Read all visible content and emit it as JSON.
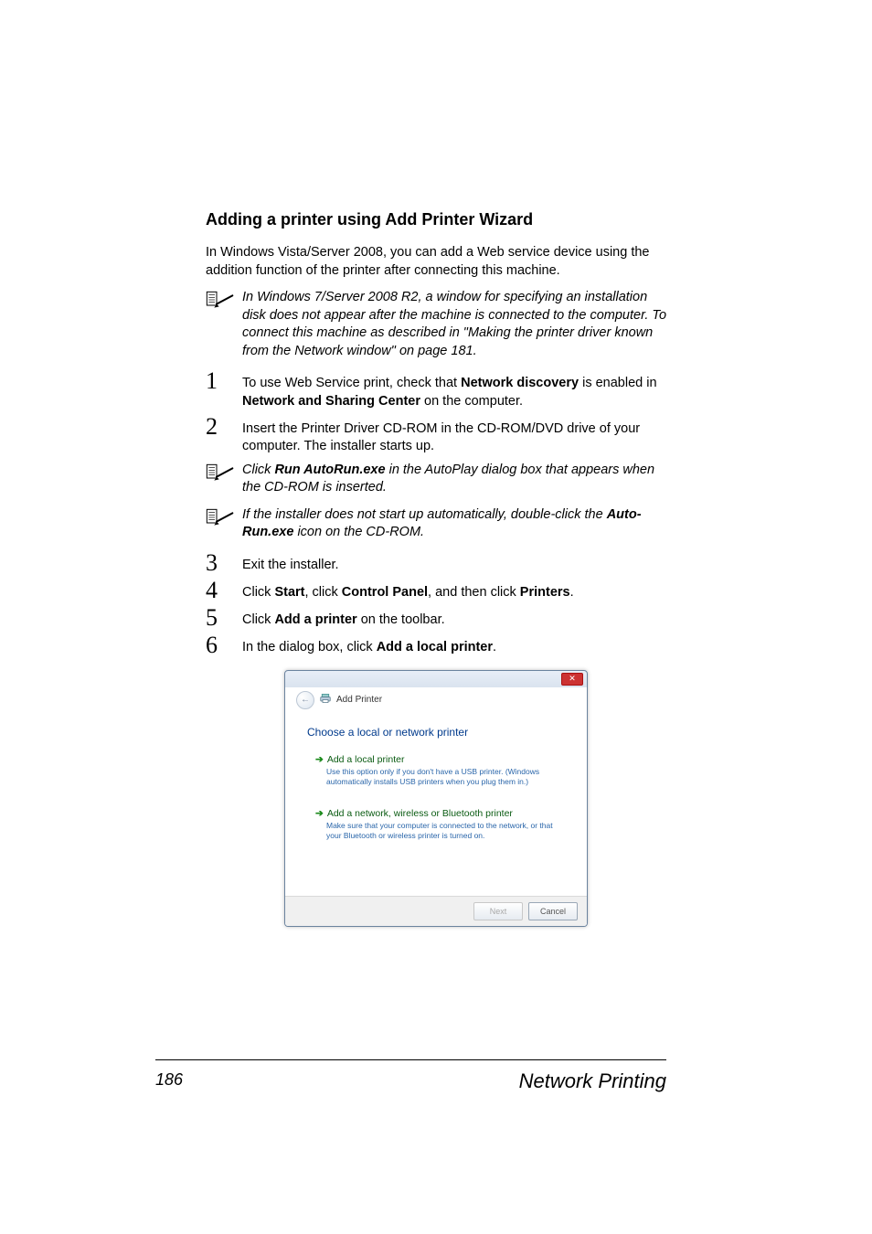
{
  "heading": "Adding a printer using Add Printer Wizard",
  "intro": "In Windows Vista/Server 2008, you can add a Web service device using the addition function of the printer after connecting this machine.",
  "notes": {
    "a": "In Windows 7/Server 2008 R2, a window for specifying an installation disk does not appear after the machine is connected to the computer. To connect this machine as described in \"Making the printer driver known from the Network window\" on page 181.",
    "b_pre": "Click ",
    "b_bold": "Run AutoRun.exe",
    "b_post": " in the AutoPlay dialog box that appears when the CD-ROM is inserted.",
    "c_pre": "If the installer does not start up automatically, double-click the ",
    "c_bold": "Auto-Run.exe",
    "c_post": " icon on the CD-ROM."
  },
  "steps": {
    "s1_pre": "To use Web Service print, check that ",
    "s1_b1": "Network discovery",
    "s1_mid": " is enabled in ",
    "s1_b2": "Network and Sharing Center",
    "s1_post": " on the computer.",
    "s2": "Insert the Printer Driver CD-ROM in the CD-ROM/DVD drive of your computer. The installer starts up.",
    "s3": "Exit the installer.",
    "s4_pre": "Click ",
    "s4_b1": "Start",
    "s4_mid1": ", click ",
    "s4_b2": "Control Panel",
    "s4_mid2": ", and then click ",
    "s4_b3": "Printers",
    "s4_post": ".",
    "s5_pre": "Click ",
    "s5_b1": "Add a printer",
    "s5_post": " on the toolbar.",
    "s6_pre": "In the dialog box, click ",
    "s6_b1": "Add a local printer",
    "s6_post": "."
  },
  "nums": {
    "n1": "1",
    "n2": "2",
    "n3": "3",
    "n4": "4",
    "n5": "5",
    "n6": "6"
  },
  "dialog": {
    "title": "Add Printer",
    "heading": "Choose a local or network printer",
    "opt1_title": "Add a local printer",
    "opt1_sub": "Use this option only if you don't have a USB printer. (Windows automatically installs USB printers when you plug them in.)",
    "opt2_title": "Add a network, wireless or Bluetooth printer",
    "opt2_sub": "Make sure that your computer is connected to the network, or that your Bluetooth or wireless printer is turned on.",
    "btn_next": "Next",
    "btn_cancel": "Cancel",
    "close_x": "✕",
    "back_arrow": "←",
    "arrow": "➔"
  },
  "footer": {
    "page": "186",
    "title": "Network Printing"
  }
}
